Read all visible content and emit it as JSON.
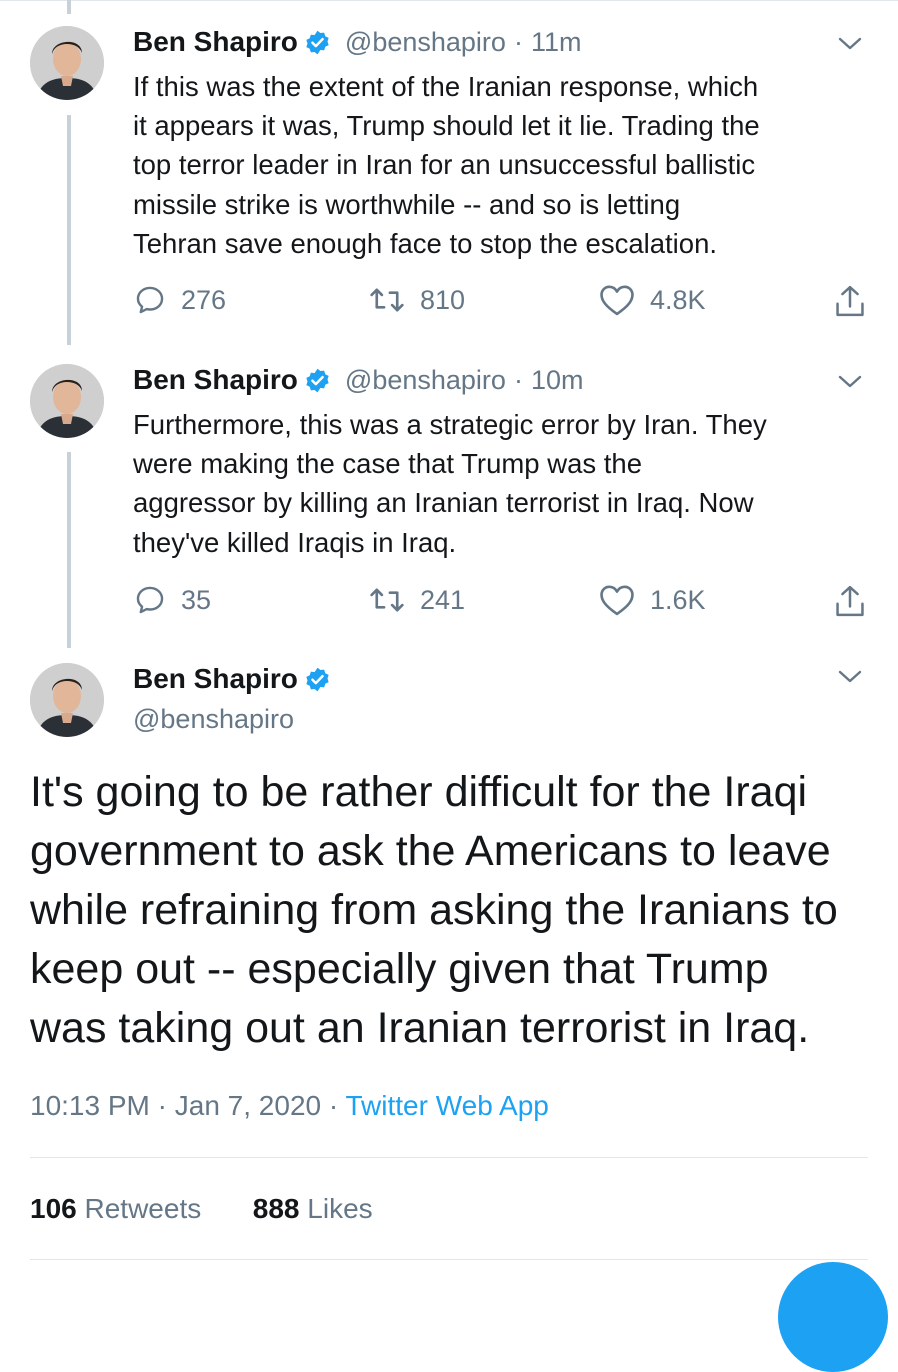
{
  "tweets": [
    {
      "name": "Ben Shapiro",
      "handle": "@benshapiro",
      "time": "11m",
      "text": "If this was the extent of the Iranian response, which\nit appears it was, Trump should let it lie. Trading the\ntop terror leader in Iran for an unsuccessful ballistic\nmissile strike is worthwhile -- and so is letting\nTehran save enough face to stop the escalation.",
      "replies": "276",
      "retweets": "810",
      "likes": "4.8K"
    },
    {
      "name": "Ben Shapiro",
      "handle": "@benshapiro",
      "time": "10m",
      "text": "Furthermore, this was a strategic error by Iran. They\nwere making the case that Trump was the\naggressor by killing an Iranian terrorist in Iraq. Now\nthey've killed Iraqis in Iraq.",
      "replies": "35",
      "retweets": "241",
      "likes": "1.6K"
    }
  ],
  "main_tweet": {
    "name": "Ben Shapiro",
    "handle": "@benshapiro",
    "text": "It's going to be rather difficult for the Iraqi\ngovernment to ask the Americans to leave\nwhile refraining from asking the Iranians to\nkeep out -- especially given that Trump\nwas taking out an Iranian terrorist in Iraq.",
    "time": "10:13 PM",
    "date": "Jan 7, 2020",
    "source": "Twitter Web App",
    "retweet_count": "106",
    "retweet_label": "Retweets",
    "like_count": "888",
    "like_label": "Likes"
  },
  "separator": "·",
  "colors": {
    "accent": "#1da1f2",
    "secondary_text": "#657786",
    "thread_line": "#c6d1d9"
  },
  "icons": [
    "verified-badge-icon",
    "chevron-down-icon",
    "reply-icon",
    "retweet-icon",
    "like-icon",
    "share-icon",
    "compose-fab"
  ]
}
